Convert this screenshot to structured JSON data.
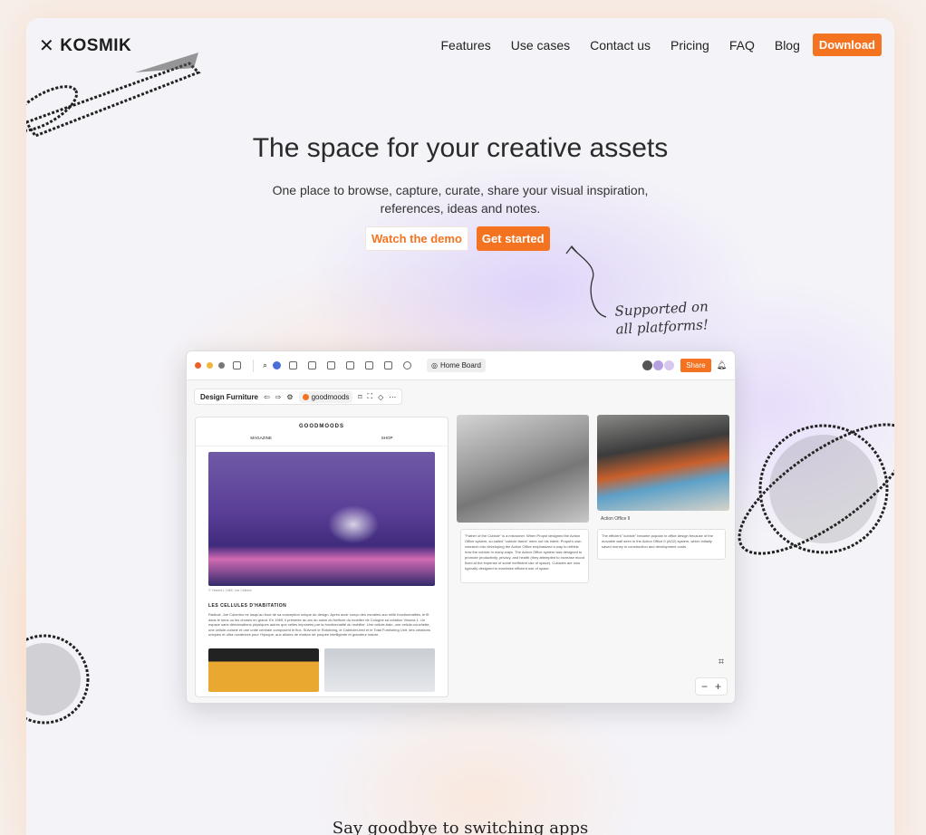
{
  "brand": {
    "name": "KOSMIK",
    "logo_icon": "kosmik-x-icon"
  },
  "nav": {
    "items": [
      "Features",
      "Use cases",
      "Contact us",
      "Pricing",
      "FAQ",
      "Blog"
    ],
    "download_label": "Download"
  },
  "hero": {
    "title": "The space for your creative assets",
    "subtitle": "One place to browse, capture, curate, share your visual inspiration, references, ideas and notes.",
    "watch_demo_label": "Watch the demo",
    "get_started_label": "Get started",
    "annotation_line1": "Supported on",
    "annotation_line2": "all platforms!"
  },
  "app": {
    "home_board_label": "Home Board",
    "share_label": "Share",
    "board_name": "Design Furniture",
    "tab_label": "goodmoods",
    "page": {
      "site_name": "GOODMOODS",
      "nav_left": "MAGAZINE",
      "nav_right": "SHOP",
      "img_credit": "© Vincent L 1969. Les Cellules",
      "heading": "LES CELLULES D'HABITATION",
      "paragraph": "Radical, Joe Colombo ne lusqu'au bout de sa conception unique du design. Après avoir conçu des meubles aux mille fonctionnalités, le fit dans le sens ou les choses en grand. En 1969, il présente au ars du salon du fortiture du mobilier de Cologne sa création Visiona 1. Un espace sans démarcations physiques autres que celles imposées par la fonctionnalité du mobilier. Une cellule-bain, une cellule-couchette, une cellule-cuisine et une unité centrale composent le flux. Suivront le Rotoliving, le Cabriolet-bed et le Total Furnishing Unit, des créations uniques et ultra novatrices pour l'époque, aux allures de maison de poupée intelligente et grandeur nature."
    },
    "photo2_caption": "Action Office II",
    "note1": "\"Father of the Cubicle\" is a misnomer. When Propst designed the Action Office system, so-called \"cubicle farms\" were not his intent. Propst's own research into developing the Action Office emphasized a way to rethink how the cubicle in many ways. The Action Office system was designed to promote productivity, privacy, and health (they attempted to increase mood fixed at the expense of some inefficient use of space). Cubicles are now typically designed to maximize efficient use of space.",
    "note2": "The efficient \"cubicle\" became popular in office design because of the movable wall seen in the Action Office II (AO2) system, which initially saved money in construction and development costs.",
    "zoom_out": "−",
    "zoom_in": "+"
  },
  "section2_title": "Say goodbye to switching apps",
  "colors": {
    "accent": "#f47321",
    "bg": "#f4f3f8"
  }
}
